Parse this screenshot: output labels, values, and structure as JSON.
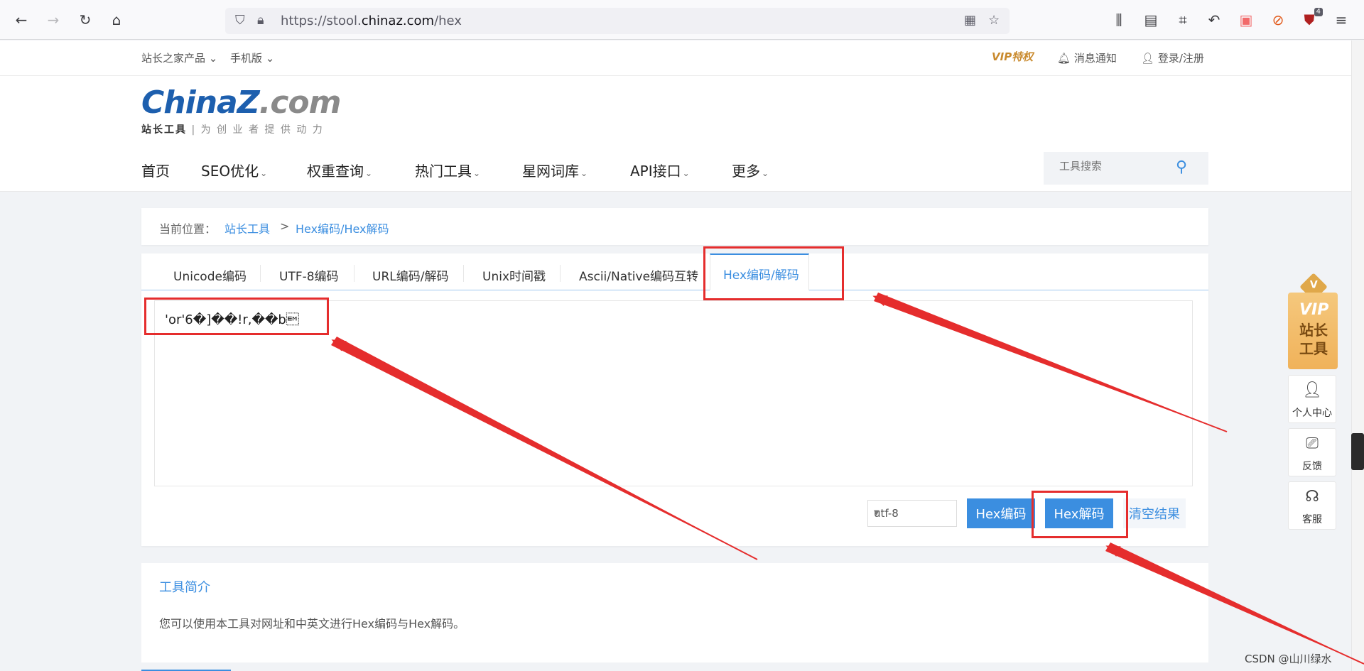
{
  "browser": {
    "url_prefix": "https://stool.",
    "url_domain": "chinaz.com",
    "url_path": "/hex",
    "extension_badge": "4"
  },
  "top_strip": {
    "products": "站长之家产品",
    "mobile": "手机版",
    "vip": "VIP特权",
    "notifications": "消息通知",
    "login": "登录/注册"
  },
  "header": {
    "logo_main": "ChinaZ",
    "logo_domain": ".com",
    "logo_sub_bold": "站长工具",
    "logo_sub": "| 为 创 业 者 提 供 动 力",
    "nav": [
      "首页",
      "SEO优化",
      "权重查询",
      "热门工具",
      "星网词库",
      "API接口",
      "更多"
    ],
    "search_placeholder": "工具搜索"
  },
  "breadcrumb": {
    "label": "当前位置：",
    "home": "站长工具",
    "separator": ">",
    "current": "Hex编码/Hex解码"
  },
  "tabs": [
    "Unicode编码",
    "UTF-8编码",
    "URL编码/解码",
    "Unix时间戳",
    "Ascii/Native编码互转"
  ],
  "active_tab": "Hex编码/解码",
  "textarea": {
    "value": "'or'6�]��!r,��b\u0019"
  },
  "controls": {
    "charset": "utf-8",
    "encode_button": "Hex编码",
    "decode_button": "Hex解码",
    "clear_button": "清空结果"
  },
  "intro": {
    "title": "工具简介",
    "text": "您可以使用本工具对网址和中英文进行Hex编码与Hex解码。"
  },
  "side": {
    "vip_top": "VIP",
    "vip_text": "站长工具",
    "diamond": "V",
    "personal": "个人中心",
    "feedback": "反馈",
    "service": "客服"
  },
  "watermark": "CSDN @山川绿水",
  "colors": {
    "accent": "#3b8ee0",
    "annotation": "#e52d2d",
    "vip_gold": "#f0b25a"
  }
}
